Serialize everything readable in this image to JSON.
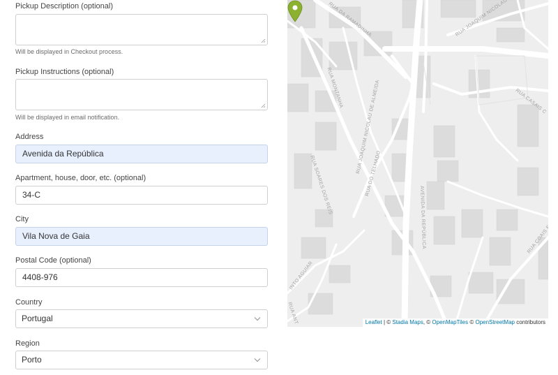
{
  "form": {
    "pickup_description": {
      "label": "Pickup Description (optional)",
      "value": "",
      "hint": "Will be displayed in Checkout process."
    },
    "pickup_instructions": {
      "label": "Pickup Instructions (optional)",
      "value": "",
      "hint": "Will be displayed in email notification."
    },
    "address": {
      "label": "Address",
      "value": "Avenida da República"
    },
    "apartment": {
      "label": "Apartment, house, door, etc. (optional)",
      "value": "34-C"
    },
    "city": {
      "label": "City",
      "value": "Vila Nova de Gaia"
    },
    "postal_code": {
      "label": "Postal Code (optional)",
      "value": "4408-976"
    },
    "country": {
      "label": "Country",
      "value": "Portugal"
    },
    "region": {
      "label": "Region",
      "value": "Porto"
    }
  },
  "map": {
    "streets": {
      "ramadinha": "RUA DA RAMADINHA",
      "joaquim_nicolau_top": "RUA JOAQUIM NICOLAU",
      "montanha": "RUA MONTANHA",
      "joaquim_nicolau_almeida": "RUA JOAQUIM NICOLAU DE ALMEIDA",
      "casais": "RUA CASAIS C",
      "telhado": "RUA DO TELHADO",
      "soares_dos_reis": "RUA SOARES DOS REIS",
      "avenida_republica": "AVENIDA DA REPÚBLICA",
      "coais": "RUA COAIS E",
      "into_aguiar": "INTO AGUIAR",
      "rua_ant": "RUA ANT"
    },
    "attribution": {
      "leaflet": "Leaflet",
      "sep1": " | © ",
      "stadia": "Stadia Maps",
      "sep2": ", © ",
      "openmaptiles": "OpenMapTiles",
      "sep3": " © ",
      "osm": "OpenStreetMap",
      "contributors": " contributors"
    },
    "marker_color": "#8cb12f"
  },
  "colors": {
    "autofill_bg": "#e8f0fe",
    "link": "#0078a8"
  },
  "icons": {
    "select_arrow": "chevron-down-icon",
    "resize": "resize-grip-icon",
    "marker": "map-marker-icon"
  }
}
